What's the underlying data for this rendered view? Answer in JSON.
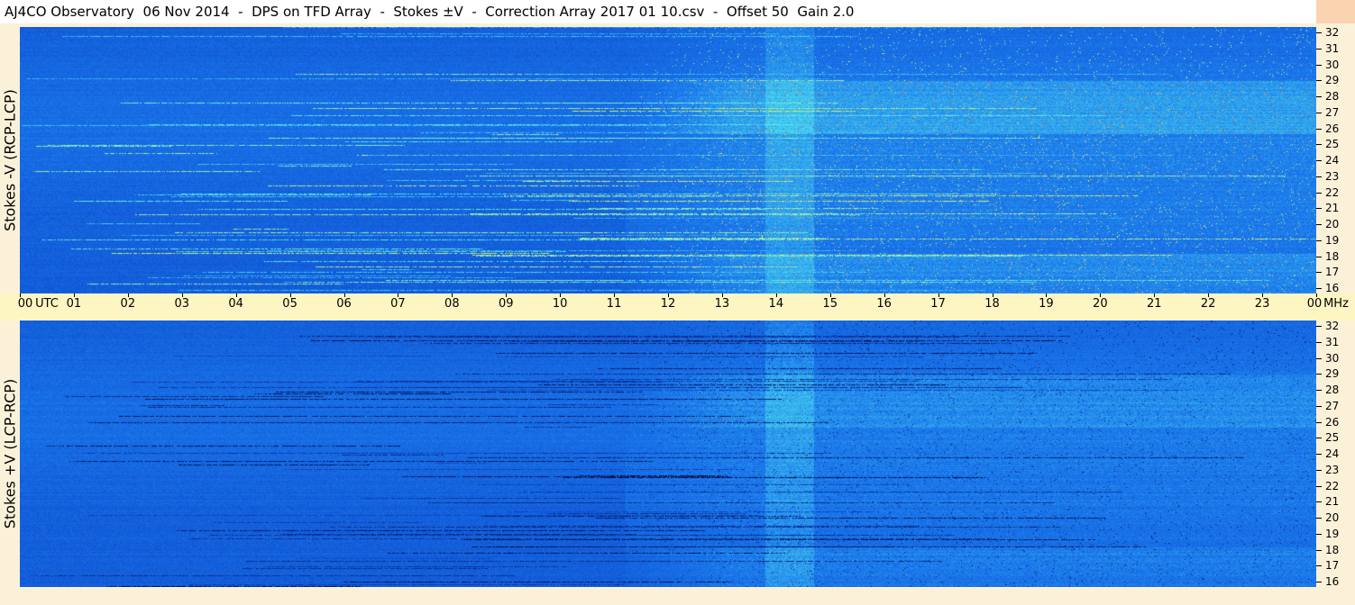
{
  "title": "AJ4CO Observatory  06 Nov 2014  -  DPS on TFD Array  -  Stokes ±V  -  Correction Array 2017 01 10.csv  -  Offset 50  Gain 2.0",
  "colors": {
    "background_low": "#0d48ca",
    "background_mid": "#1a76eb",
    "highlight_cyan": "#52e8f0",
    "highlight_yellow": "#f7ec55",
    "highlight_red": "#e52d2d",
    "dark_band": "#03042e",
    "axis_bg_yellow": "#fdf6c2",
    "axis_bg_peach": "#fad3b0"
  },
  "chart_data": {
    "type": "heatmap",
    "panels": [
      {
        "ylabel": "Stokes -V (RCP-LCP)",
        "y_unit": "MHz",
        "ylim": [
          16,
          32
        ],
        "yticks": [
          "16",
          "17",
          "18",
          "19",
          "20",
          "21",
          "22",
          "23",
          "24",
          "25",
          "26",
          "27",
          "28",
          "29",
          "30",
          "31",
          "32"
        ],
        "activity_start_hour": 11.2,
        "activity_end_hour": 24.0,
        "bright_band_hours": [
          13.8,
          14.7
        ],
        "polarity": "minus"
      },
      {
        "ylabel": "Stokes +V (LCP-RCP)",
        "y_unit": "MHz",
        "ylim": [
          16,
          32
        ],
        "yticks": [
          "16",
          "17",
          "18",
          "19",
          "20",
          "21",
          "22",
          "23",
          "24",
          "25",
          "26",
          "27",
          "28",
          "29",
          "30",
          "31",
          "32"
        ],
        "activity_start_hour": 11.2,
        "activity_end_hour": 24.0,
        "bright_band_hours": [
          13.8,
          14.7
        ],
        "polarity": "plus"
      }
    ],
    "x_axis": {
      "xlim_hours": [
        0,
        24
      ],
      "ticks": [
        "00",
        "01",
        "02",
        "03",
        "04",
        "05",
        "06",
        "07",
        "08",
        "09",
        "10",
        "11",
        "12",
        "13",
        "14",
        "15",
        "16",
        "17",
        "18",
        "19",
        "20",
        "21",
        "22",
        "23",
        "00"
      ],
      "utc_label": "UTC",
      "unit_label": "MHz"
    }
  }
}
